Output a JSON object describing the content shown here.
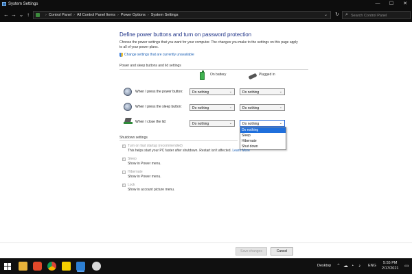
{
  "window": {
    "title": "System Settings",
    "min_glyph": "—",
    "max_glyph": "☐",
    "close_glyph": "✕"
  },
  "nav": {
    "back_glyph": "←",
    "forward_glyph": "→",
    "recent_glyph": "⌄",
    "up_glyph": "↑",
    "breadcrumbs": [
      "Control Panel",
      "All Control Panel Items",
      "Power Options",
      "System Settings"
    ],
    "separator": "›",
    "dropdown_glyph": "⌄",
    "refresh_glyph": "↻",
    "search_placeholder": "Search Control Panel",
    "search_glyph": "⌕"
  },
  "page": {
    "title": "Define power buttons and turn on password protection",
    "description": "Choose the power settings that you want for your computer. The changes you make to the settings on this page apply to all of your power plans.",
    "change_settings_link": "Change settings that are currently unavailable"
  },
  "power_section": {
    "title": "Power and sleep buttons and lid settings",
    "columns": [
      "On battery",
      "Plugged in"
    ],
    "rows": [
      {
        "label": "When I press the power button:",
        "on_battery": "Do nothing",
        "plugged_in": "Do nothing",
        "icon": "power-button-icon"
      },
      {
        "label": "When I press the sleep button:",
        "on_battery": "Do nothing",
        "plugged_in": "Do nothing",
        "icon": "sleep-button-icon"
      },
      {
        "label": "When I close the lid:",
        "on_battery": "Do nothing",
        "plugged_in": "Do nothing",
        "icon": "laptop-lid-icon"
      }
    ],
    "dropdown_options": [
      "Do nothing",
      "Sleep",
      "Hibernate",
      "Shut down"
    ],
    "dropdown_selected": "Do nothing"
  },
  "shutdown_section": {
    "title": "Shutdown settings",
    "options": [
      {
        "label": "Turn on fast startup (recommended)",
        "description": "This helps start your PC faster after shutdown. Restart isn't affected.",
        "link": "Learn More",
        "checked": true
      },
      {
        "label": "Sleep",
        "description": "Show in Power menu.",
        "checked": true
      },
      {
        "label": "Hibernate",
        "description": "Show in Power menu.",
        "checked": false
      },
      {
        "label": "Lock",
        "description": "Show in account picture menu.",
        "checked": true
      }
    ]
  },
  "buttons": {
    "save": "Save changes",
    "cancel": "Cancel"
  },
  "taskbar": {
    "desktop_label": "Desktop",
    "language": "ENG",
    "time": "5:55 PM",
    "date": "2/17/2021",
    "chevron_glyph": "⌃"
  },
  "colors": {
    "title_blue": "#1e3287",
    "link_blue": "#1a5fb4",
    "selection_blue": "#1f6fdc",
    "chrome_dark": "#0d0d0d"
  }
}
